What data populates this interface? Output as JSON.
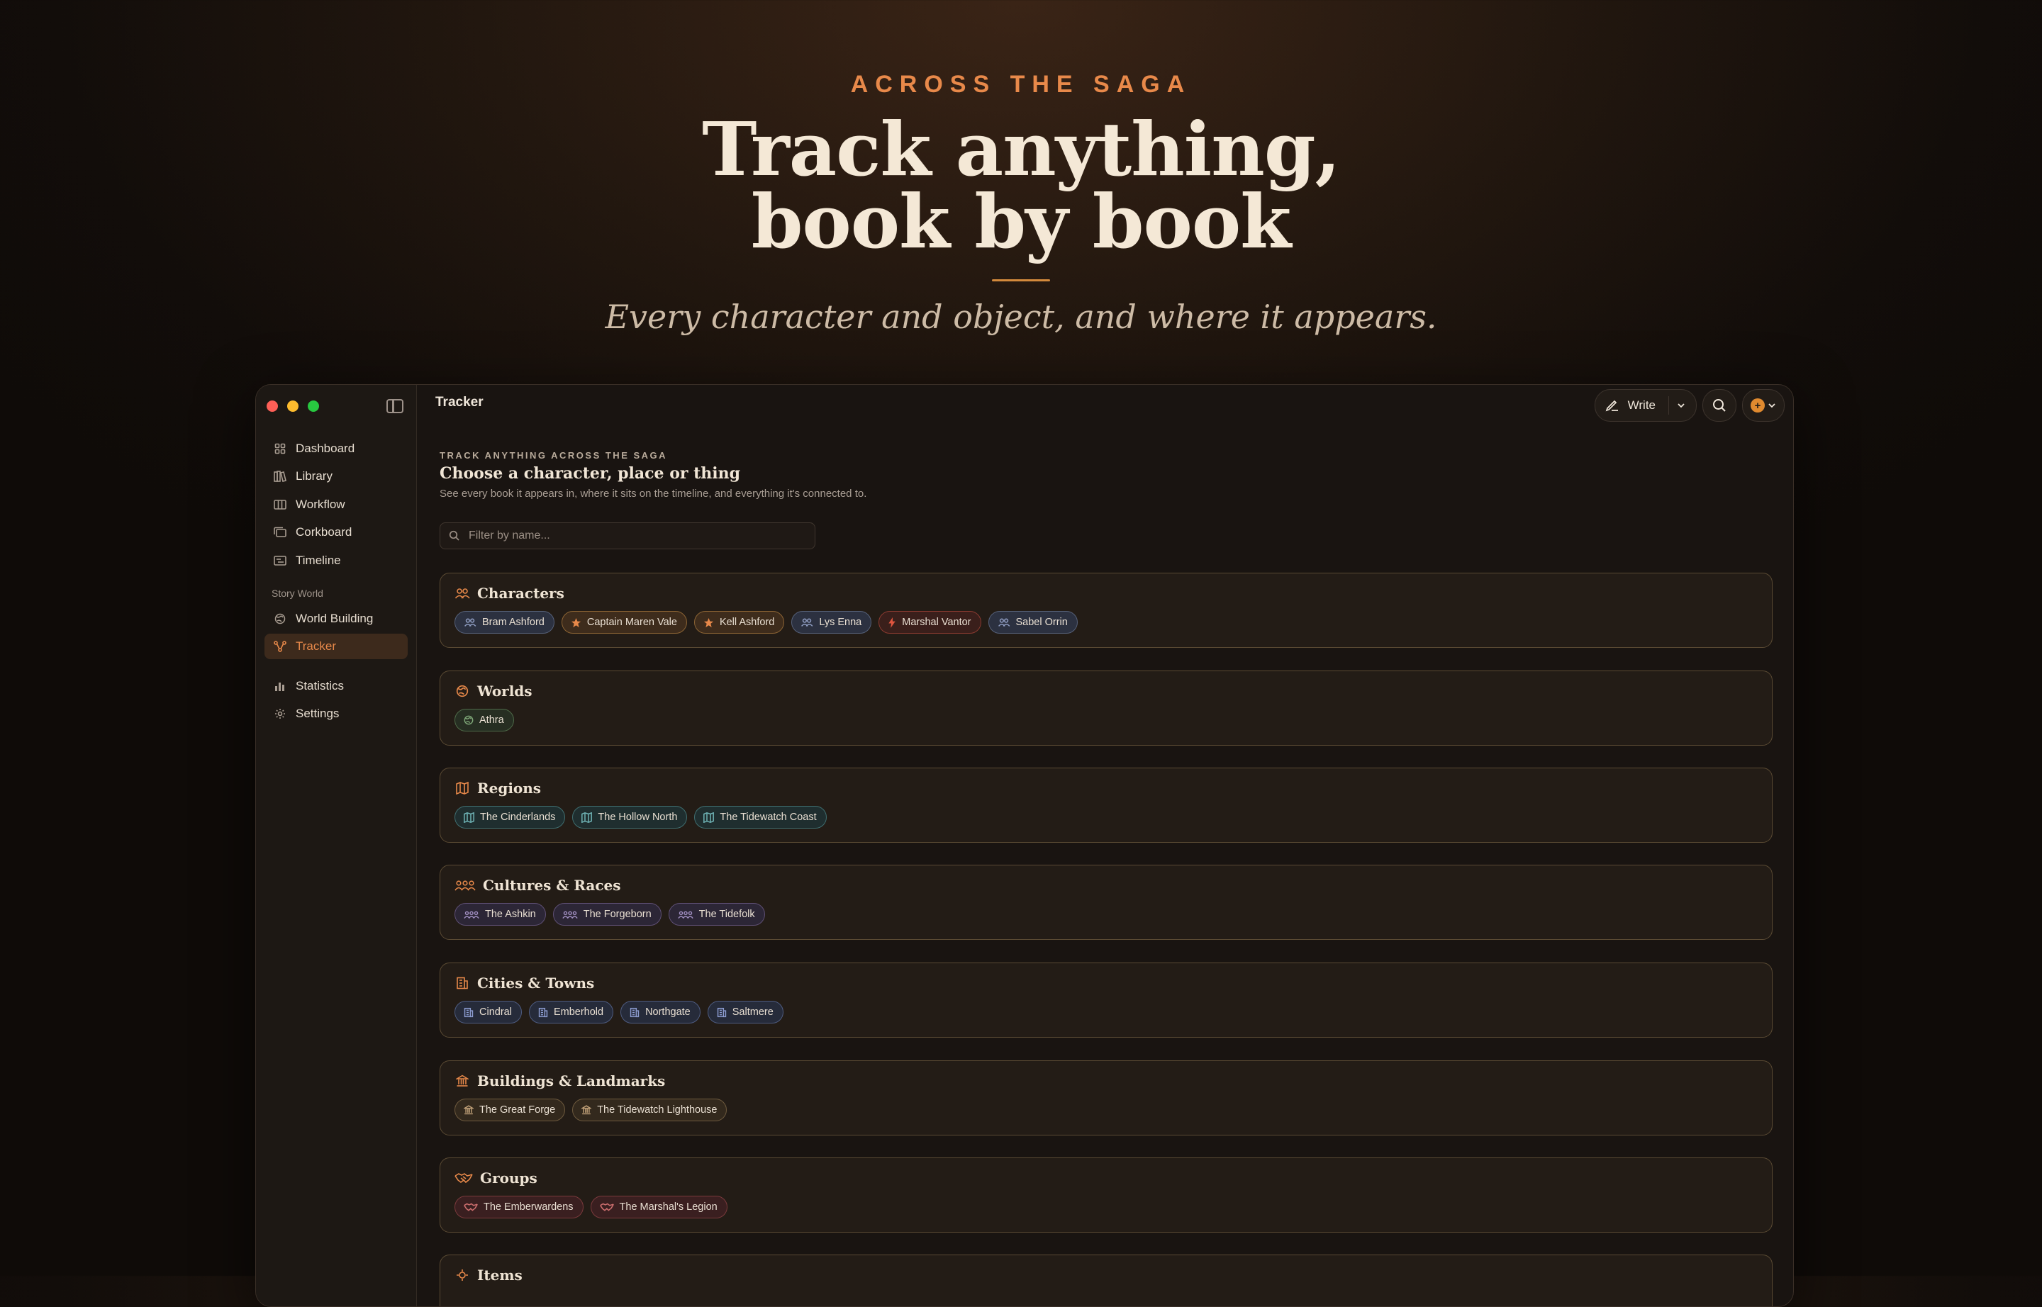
{
  "hero": {
    "eyebrow": "ACROSS THE SAGA",
    "headline_line1": "Track anything,",
    "headline_line2": "book by book",
    "tagline": "Every character and object, and where it appears."
  },
  "window": {
    "title": "Tracker"
  },
  "sidebar": {
    "items": [
      {
        "label": "Dashboard",
        "icon": "grid-icon"
      },
      {
        "label": "Library",
        "icon": "books-icon"
      },
      {
        "label": "Workflow",
        "icon": "columns-icon"
      },
      {
        "label": "Corkboard",
        "icon": "cards-icon"
      },
      {
        "label": "Timeline",
        "icon": "timeline-icon"
      }
    ],
    "section_label": "Story World",
    "world_items": [
      {
        "label": "World Building",
        "icon": "globe-icon"
      },
      {
        "label": "Tracker",
        "icon": "tracker-icon",
        "active": true
      }
    ],
    "bottom_items": [
      {
        "label": "Statistics",
        "icon": "bar-chart-icon"
      },
      {
        "label": "Settings",
        "icon": "gear-icon"
      }
    ]
  },
  "toolbar": {
    "write_label": "Write"
  },
  "page": {
    "kicker": "TRACK ANYTHING ACROSS THE SAGA",
    "title": "Choose a character, place or thing",
    "subtitle": "See every book it appears in, where it sits on the timeline, and everything it's connected to.",
    "filter_placeholder": "Filter by name..."
  },
  "categories": [
    {
      "title": "Characters",
      "items": [
        "Bram Ashford",
        "Captain Maren Vale",
        "Kell Ashford",
        "Lys Enna",
        "Marshal Vantor",
        "Sabel Orrin"
      ]
    },
    {
      "title": "Worlds",
      "items": [
        "Athra"
      ]
    },
    {
      "title": "Regions",
      "items": [
        "The Cinderlands",
        "The Hollow North",
        "The Tidewatch Coast"
      ]
    },
    {
      "title": "Cultures & Races",
      "items": [
        "The Ashkin",
        "The Forgeborn",
        "The Tidefolk"
      ]
    },
    {
      "title": "Cities & Towns",
      "items": [
        "Cindral",
        "Emberhold",
        "Northgate",
        "Saltmere"
      ]
    },
    {
      "title": "Buildings & Landmarks",
      "items": [
        "The Great Forge",
        "The Tidewatch Lighthouse"
      ]
    },
    {
      "title": "Groups",
      "items": [
        "The Emberwardens",
        "The Marshal's Legion"
      ]
    },
    {
      "title": "Items",
      "items": []
    }
  ],
  "colors": {
    "accent": "#e8894a",
    "character_chip": "#5a6a8a",
    "protagonist_chip": "#d48a3c",
    "antagonist_chip": "#b0453a",
    "world_chip": "#5d8a5a",
    "region_chip": "#4f8c8c",
    "culture_chip": "#7d6a9a",
    "city_chip": "#5d6f96",
    "building_chip": "#8c7250",
    "group_chip": "#a0484a"
  }
}
